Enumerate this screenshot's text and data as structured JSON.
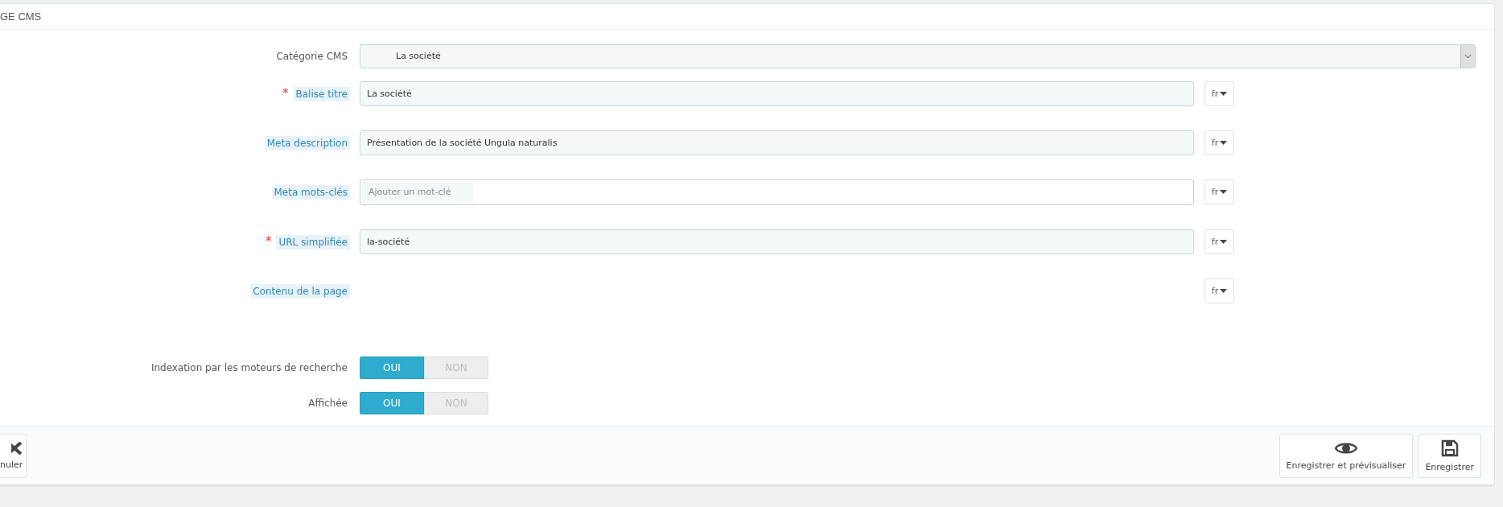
{
  "panel": {
    "title": "GE CMS"
  },
  "fields": [
    {
      "kind": "select",
      "label": "Catégorie CMS",
      "hint": false,
      "value": "La société"
    },
    {
      "kind": "text",
      "required_mark": "*",
      "label": "Balise titre",
      "hint": true,
      "value": "La société",
      "lang": "fr"
    },
    {
      "kind": "text",
      "label": "Meta description",
      "hint": true,
      "value": "Présentation de la société Ungula naturalis",
      "lang": "fr"
    },
    {
      "kind": "tags",
      "label": "Meta mots-clés",
      "hint": true,
      "placeholder": "Ajouter un mot-clé",
      "lang": "fr"
    },
    {
      "kind": "text",
      "required_mark": "*",
      "label": "URL simplifiée",
      "hint": true,
      "value": "la-société",
      "lang": "fr"
    },
    {
      "kind": "editor",
      "label": "Contenu de la page",
      "hint": true,
      "lang": "fr"
    },
    {
      "kind": "switch",
      "label": "Indexation par les moteurs de recherche",
      "hint": false,
      "options": [
        {
          "label": "OUI",
          "selected": true
        },
        {
          "label": "NON",
          "selected": false
        }
      ]
    },
    {
      "kind": "switch",
      "label": "Affichée",
      "hint": false,
      "options": [
        {
          "label": "OUI",
          "selected": true
        },
        {
          "label": "NON",
          "selected": false
        }
      ]
    }
  ],
  "footer": {
    "cancel": "nuler",
    "actions": [
      {
        "kind": "preview",
        "label": "Enregistrer et prévisualiser"
      },
      {
        "kind": "save",
        "label": "Enregistrer"
      }
    ]
  }
}
